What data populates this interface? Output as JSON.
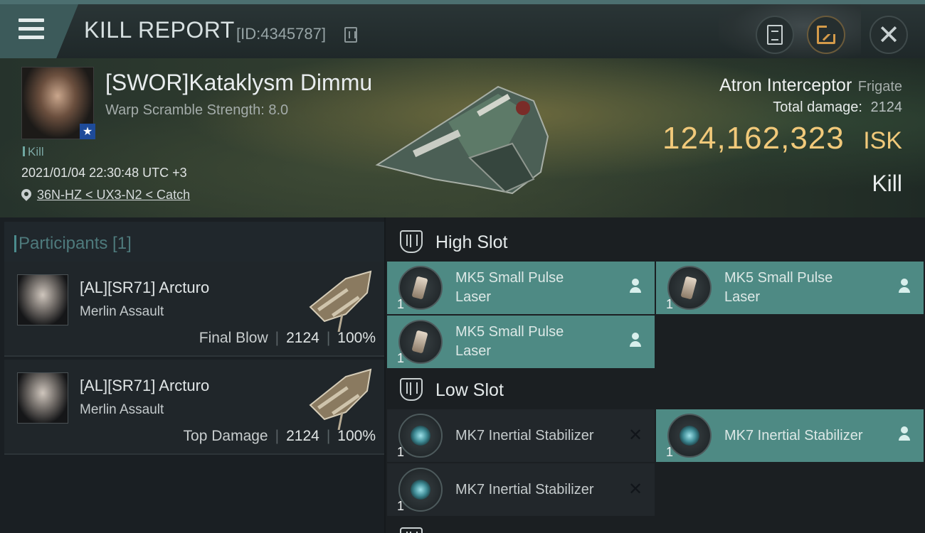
{
  "header": {
    "title": "KILL REPORT",
    "report_id": "[ID:4345787]",
    "icons": {
      "menu": "hamburger-icon",
      "copy": "copy-icon",
      "notes": "clipboard-icon",
      "share": "share-icon",
      "close": "close-icon"
    },
    "close_glyph": "✕"
  },
  "victim": {
    "name": "[SWOR]Kataklysm Dimmu",
    "stat": "Warp Scramble Strength: 8.0",
    "tag": "Kill",
    "datetime": "2021/01/04 22:30:48 UTC +3",
    "location": "36N-HZ < UX3-N2 < Catch",
    "ship_name": "Atron Interceptor",
    "ship_class": "Frigate",
    "total_damage_label": "Total damage:",
    "total_damage": "2124",
    "isk_value": "124,162,323",
    "isk_unit": "ISK",
    "outcome": "Kill",
    "badge_glyph": "★"
  },
  "participants": {
    "label": "Participants [1]",
    "items": [
      {
        "name": "[AL][SR71] Arcturo",
        "ship": "Merlin Assault",
        "role": "Final Blow",
        "damage": "2124",
        "percent": "100%"
      },
      {
        "name": "[AL][SR71] Arcturo",
        "ship": "Merlin Assault",
        "role": "Top Damage",
        "damage": "2124",
        "percent": "100%"
      }
    ]
  },
  "fitting": {
    "high_slot": {
      "title": "High Slot",
      "modules": [
        {
          "name_line1": "MK5 Small Pulse",
          "name_line2": "Laser",
          "qty": "1",
          "status": "dropped"
        },
        {
          "name_line1": "MK5 Small Pulse",
          "name_line2": "Laser",
          "qty": "1",
          "status": "dropped"
        },
        {
          "name_line1": "MK5 Small Pulse",
          "name_line2": "Laser",
          "qty": "1",
          "status": "dropped"
        }
      ]
    },
    "low_slot": {
      "title": "Low Slot",
      "modules": [
        {
          "name_line1": "MK7 Inertial Stabilizer",
          "qty": "1",
          "status": "destroyed"
        },
        {
          "name_line1": "MK7 Inertial Stabilizer",
          "qty": "1",
          "status": "dropped"
        },
        {
          "name_line1": "MK7 Inertial Stabilizer",
          "qty": "1",
          "status": "destroyed"
        }
      ]
    },
    "destroyed_glyph": "✕"
  },
  "colors": {
    "accent_teal": "#4e8a84",
    "isk_gold": "#f1c97a",
    "title_strip": "#4c6f70"
  }
}
